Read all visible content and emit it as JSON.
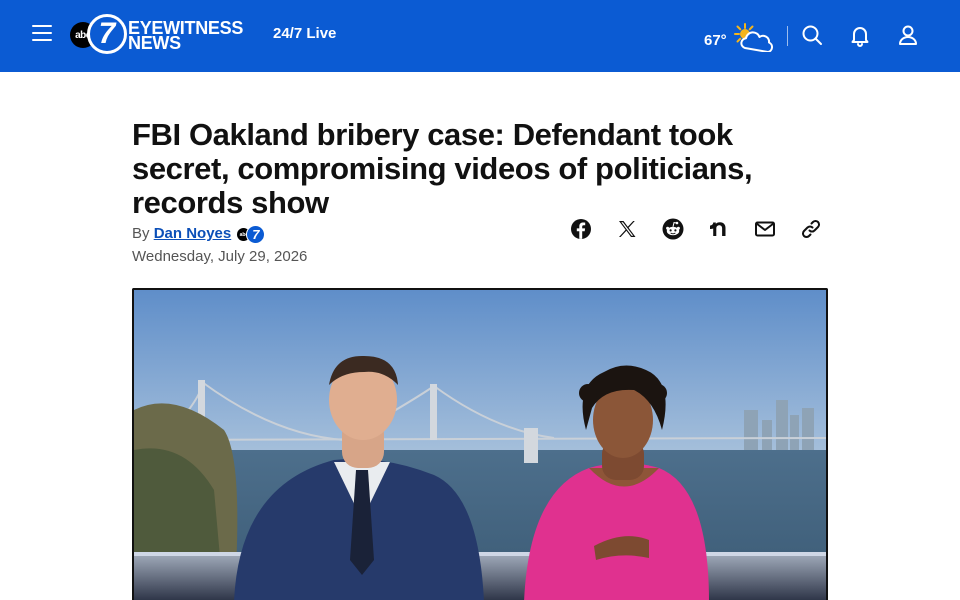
{
  "header": {
    "live_label": "24/7 Live",
    "logo": {
      "abc": "abc",
      "seven": "7",
      "line1": "EYEWITNESS",
      "line2": "NEWS"
    },
    "weather": {
      "temperature": "67°",
      "icon": "partly-cloudy-icon"
    },
    "icons": [
      "menu-icon",
      "search-icon",
      "bell-icon",
      "user-icon"
    ],
    "brand_color": "#0b5bd3"
  },
  "article": {
    "headline": "FBI Oakland bribery case: Defendant took secret, compromising videos of politicians, records show",
    "byline_prefix": "By",
    "author": "Dan Noyes",
    "author_badge": {
      "abc": "abc",
      "seven": "7"
    },
    "date": "Wednesday, July 29, 2026"
  },
  "share": {
    "icons": [
      "facebook-icon",
      "x-icon",
      "reddit-icon",
      "nextdoor-icon",
      "email-icon",
      "link-icon"
    ]
  },
  "media": {
    "type": "video-still",
    "description_icon": "news-anchors-image"
  }
}
